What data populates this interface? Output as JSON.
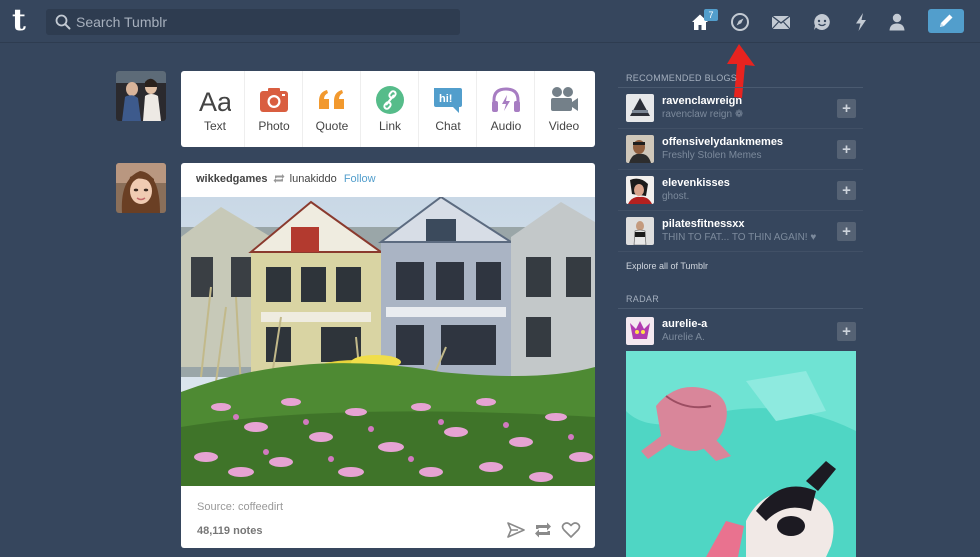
{
  "header": {
    "logo": "t",
    "search": {
      "placeholder": "Search Tumblr"
    },
    "nav": [
      "home-icon",
      "explore-icon",
      "inbox-icon",
      "messaging-icon",
      "activity-icon",
      "account-icon",
      "compose-icon"
    ],
    "home_badge": "7"
  },
  "post_types": [
    {
      "label": "Text",
      "icon": "text-icon",
      "color": "#444444"
    },
    {
      "label": "Photo",
      "icon": "camera-icon",
      "color": "#d95e40"
    },
    {
      "label": "Quote",
      "icon": "quote-icon",
      "color": "#f2992e"
    },
    {
      "label": "Link",
      "icon": "link-icon",
      "color": "#56bc8a"
    },
    {
      "label": "Chat",
      "icon": "chat-icon",
      "color": "#529ecc"
    },
    {
      "label": "Audio",
      "icon": "headphones-icon",
      "color": "#a77dc2"
    },
    {
      "label": "Video",
      "icon": "video-camera-icon",
      "color": "#748089"
    }
  ],
  "post": {
    "user": "wikkedgames",
    "reblogged_from": "lunakiddo",
    "follow_label": "Follow",
    "source": "Source: coffeedirt",
    "notes": "48,119 notes",
    "actions": [
      "share-icon",
      "reblog-icon",
      "like-icon"
    ]
  },
  "sidebar": {
    "recommended_title": "RECOMMENDED BLOGS",
    "blogs": [
      {
        "name": "ravenclawreign",
        "desc": "ravenclaw reign ❁"
      },
      {
        "name": "offensivelydankmemes",
        "desc": "Freshly Stolen Memes"
      },
      {
        "name": "elevenkisses",
        "desc": "ghost."
      },
      {
        "name": "pilatesfitnessxx",
        "desc": "THIN TO FAT... TO THIN AGAIN! ♥"
      }
    ],
    "explore_label": "Explore all of Tumblr",
    "radar_title": "RADAR",
    "radar": {
      "name": "aurelie-a",
      "desc": "Aurelie A."
    },
    "follow_symbol": "+"
  },
  "colors": {
    "background": "#36465d",
    "accent": "#529ecc",
    "annotation_arrow": "#e8231f"
  }
}
